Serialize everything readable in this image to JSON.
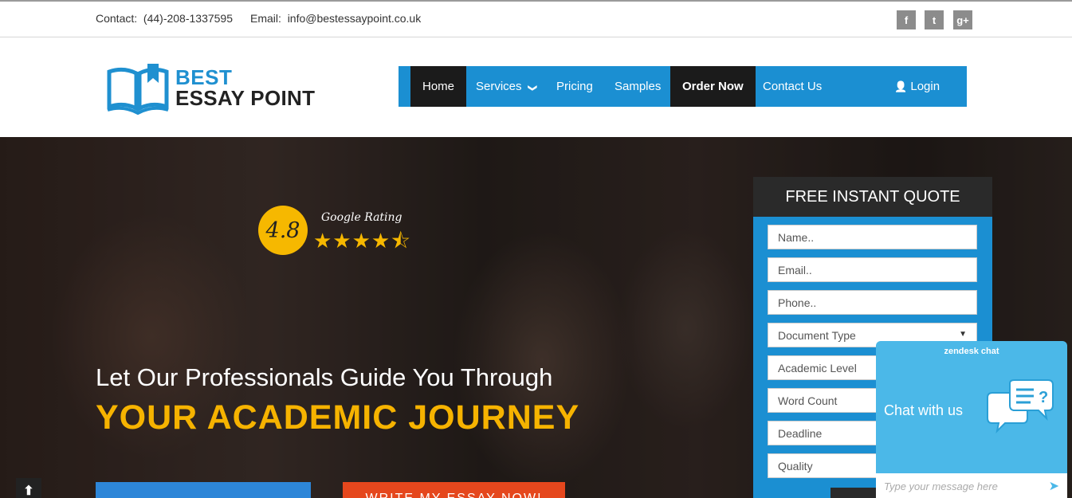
{
  "topbar": {
    "contact_label": "Contact:",
    "contact_phone": "(44)-208-1337595",
    "email_label": "Email:",
    "email_value": "info@bestessaypoint.co.uk",
    "social": [
      {
        "glyph": "f",
        "icon": "facebook-icon"
      },
      {
        "glyph": "t",
        "icon": "twitter-icon"
      },
      {
        "glyph": "g+",
        "icon": "google-plus-icon"
      }
    ]
  },
  "logo": {
    "line1": "BEST",
    "line2": "ESSAY POINT"
  },
  "nav": {
    "home": "Home",
    "services": "Services",
    "services_caret": "❯",
    "pricing": "Pricing",
    "samples": "Samples",
    "order_now": "Order Now",
    "contact_us": "Contact Us",
    "login_icon": "👤",
    "login": "Login"
  },
  "hero": {
    "rating_value": "4.8",
    "rating_label": "Google Rating",
    "rating_stars": 4.5,
    "stars_glyphs": "★★★★⯪",
    "headline1": "Let Our Professionals Guide You Through",
    "headline2": "YOUR ACADEMIC JOURNEY",
    "cta_red": "WRITE MY ESSAY NOW!",
    "scroll_top_glyph": "⬆"
  },
  "quote": {
    "title": "FREE INSTANT QUOTE",
    "name_placeholder": "Name..",
    "email_placeholder": "Email..",
    "phone_placeholder": "Phone..",
    "document_type": "Document Type",
    "academic_level": "Academic Level",
    "word_count": "Word Count",
    "deadline": "Deadline",
    "quality": "Quality",
    "caret": "▼"
  },
  "chat": {
    "brand": "zendesk chat",
    "title": "Chat with us",
    "placeholder": "Type your message here",
    "send_glyph": "➤"
  },
  "colors": {
    "brand_blue": "#1b8fd2",
    "accent_yellow": "#f6b300",
    "cta_red": "#e5471d",
    "dark": "#1b1b1b",
    "chat_blue": "#4bb8e8"
  }
}
